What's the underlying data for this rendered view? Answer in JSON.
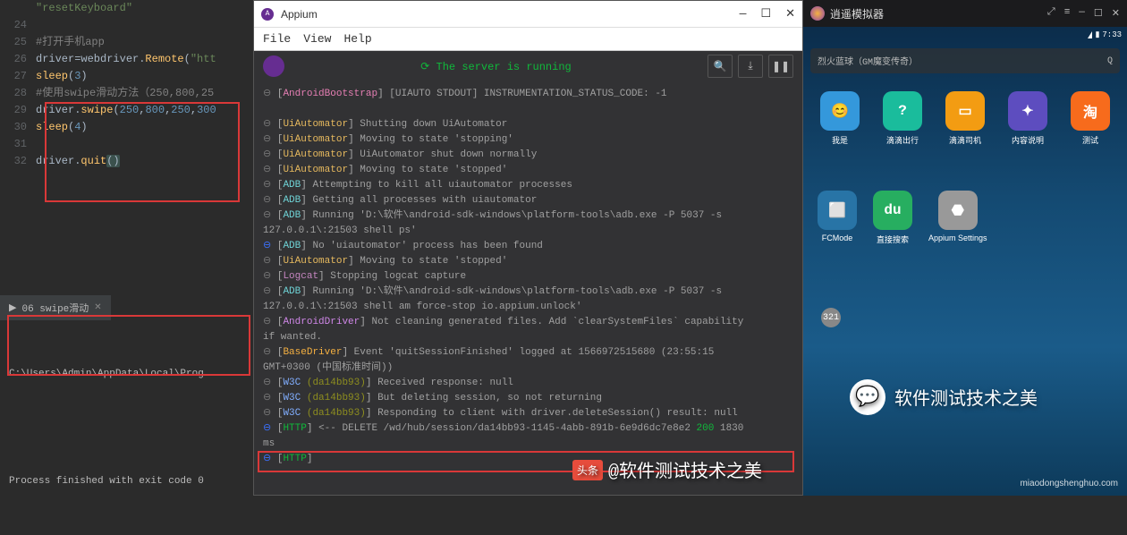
{
  "editor": {
    "lines": [
      {
        "n": "",
        "html": "<span class='str'>\"resetKeyboard\"</span>"
      },
      {
        "n": "24",
        "html": ""
      },
      {
        "n": "25",
        "html": "<span class='comment'>#打开手机app</span>"
      },
      {
        "n": "26",
        "html": "driver=webdriver.<span class='fn'>Remote</span>(<span class='str'>\"htt</span>"
      },
      {
        "n": "27",
        "html": "<span class='fn'>sleep</span>(<span class='num'>3</span>)"
      },
      {
        "n": "28",
        "html": "<span class='comment'>#使用swipe滑动方法（250,800,25</span>"
      },
      {
        "n": "29",
        "html": "driver.<span class='fn'>swipe</span>(<span class='num'>250</span>,<span class='num'>800</span>,<span class='num'>250</span>,<span class='num'>300</span>"
      },
      {
        "n": "30",
        "html": "<span class='fn'>sleep</span>(<span class='num'>4</span>)"
      },
      {
        "n": "31",
        "html": ""
      },
      {
        "n": "32",
        "html": "driver.<span class='fn'>quit</span><span class='paren'>()</span>"
      }
    ]
  },
  "runpanel": {
    "tab": "06 swipe滑动",
    "line1": "C:\\Users\\Admin\\AppData\\Local\\Prog",
    "line2": "Process finished with exit code 0"
  },
  "appium": {
    "title": "Appium",
    "menu": [
      "File",
      "View",
      "Help"
    ],
    "status": "The server is running",
    "btn_search": "🔍",
    "btn_download": "⤓",
    "btn_pause": "❚❚",
    "logs": [
      {
        "b": "grey",
        "tag": "AndroidBootstrap",
        "cls": "tag-ab",
        "txt": "[UIAUTO STDOUT] INSTRUMENTATION_STATUS_CODE: -1"
      },
      {
        "br": 1
      },
      {
        "b": "grey",
        "tag": "UiAutomator",
        "cls": "tag-uia",
        "txt": "Shutting down UiAutomator"
      },
      {
        "b": "grey",
        "tag": "UiAutomator",
        "cls": "tag-uia",
        "txt": "Moving to state 'stopping'"
      },
      {
        "b": "grey",
        "tag": "UiAutomator",
        "cls": "tag-uia",
        "txt": "UiAutomator shut down normally"
      },
      {
        "b": "grey",
        "tag": "UiAutomator",
        "cls": "tag-uia",
        "txt": "Moving to state 'stopped'"
      },
      {
        "b": "grey",
        "tag": "ADB",
        "cls": "tag-adb",
        "txt": "Attempting to kill all uiautomator processes"
      },
      {
        "b": "grey",
        "tag": "ADB",
        "cls": "tag-adb",
        "txt": "Getting all processes with uiautomator"
      },
      {
        "b": "grey",
        "tag": "ADB",
        "cls": "tag-adb",
        "txt": "Running 'D:\\软件\\android-sdk-windows\\platform-tools\\adb.exe -P 5037 -s"
      },
      {
        "txt": "127.0.0.1\\:21503 shell ps'"
      },
      {
        "b": "blue",
        "tag": "ADB",
        "cls": "tag-adb",
        "txt": "No 'uiautomator' process has been found"
      },
      {
        "b": "grey",
        "tag": "UiAutomator",
        "cls": "tag-uia",
        "txt": "Moving to state 'stopped'"
      },
      {
        "b": "grey",
        "tag": "Logcat",
        "cls": "tag-logcat",
        "txt": "Stopping logcat capture"
      },
      {
        "b": "grey",
        "tag": "ADB",
        "cls": "tag-adb",
        "txt": "Running 'D:\\软件\\android-sdk-windows\\platform-tools\\adb.exe -P 5037 -s"
      },
      {
        "txt": "127.0.0.1\\:21503 shell am force-stop io.appium.unlock'"
      },
      {
        "b": "grey",
        "tag": "AndroidDriver",
        "cls": "tag-abd",
        "txt": "Not cleaning generated files. Add `clearSystemFiles` capability"
      },
      {
        "txt": "if wanted."
      },
      {
        "b": "grey",
        "tag": "BaseDriver",
        "cls": "tag-base",
        "txt": "Event 'quitSessionFinished' logged at 1566972515680 (23:55:15"
      },
      {
        "txt": "GMT+0300 (中国标准时间))"
      },
      {
        "b": "grey",
        "tag": "W3C (da14bb93)",
        "cls": "tag-w3c",
        "sess": 1,
        "txt": "Received response: null"
      },
      {
        "b": "grey",
        "tag": "W3C (da14bb93)",
        "cls": "tag-w3c",
        "sess": 1,
        "txt": "But deleting session, so not returning"
      },
      {
        "b": "grey",
        "tag": "W3C (da14bb93)",
        "cls": "tag-w3c",
        "sess": 1,
        "txt": "Responding to client with driver.deleteSession() result: null"
      },
      {
        "b": "blue",
        "tag": "HTTP",
        "cls": "tag-http",
        "http": 1,
        "txt": "<-- DELETE /wd/hub/session/da14bb93-1145-4abb-891b-6e9d6dc7e8e2",
        "code": "200",
        "ms": "1830"
      },
      {
        "txt": "ms"
      },
      {
        "b": "blue",
        "tag": "HTTP",
        "cls": "tag-http",
        "txt": ""
      }
    ]
  },
  "emu": {
    "title": "逍遥模拟器",
    "time": "7:33",
    "search": "烈火蓝球（GM魔变传奇）",
    "apps_r1": [
      {
        "label": "我是",
        "cls": "ic1",
        "g": "😊"
      },
      {
        "label": "滴滴出行",
        "cls": "ic2",
        "g": "?"
      },
      {
        "label": "滴滴司机",
        "cls": "ic3",
        "g": "▭"
      },
      {
        "label": "内容说明",
        "cls": "ic4",
        "g": "✦"
      },
      {
        "label": "测试",
        "cls": "ic5",
        "g": "淘"
      }
    ],
    "apps_r2": [
      {
        "label": "FCMode",
        "cls": "ic6",
        "g": "⬜"
      },
      {
        "label": "直接搜索",
        "cls": "ic7",
        "g": "du"
      },
      {
        "label": "Appium Settings",
        "cls": "ic8",
        "g": "⬣"
      }
    ],
    "circle": "321"
  },
  "wechat": {
    "icon": "💬",
    "text": "软件测试技术之美"
  },
  "tt": {
    "badge": "头条",
    "text": "@软件测试技术之美"
  },
  "watermark": "miaodongshenghuo.com"
}
